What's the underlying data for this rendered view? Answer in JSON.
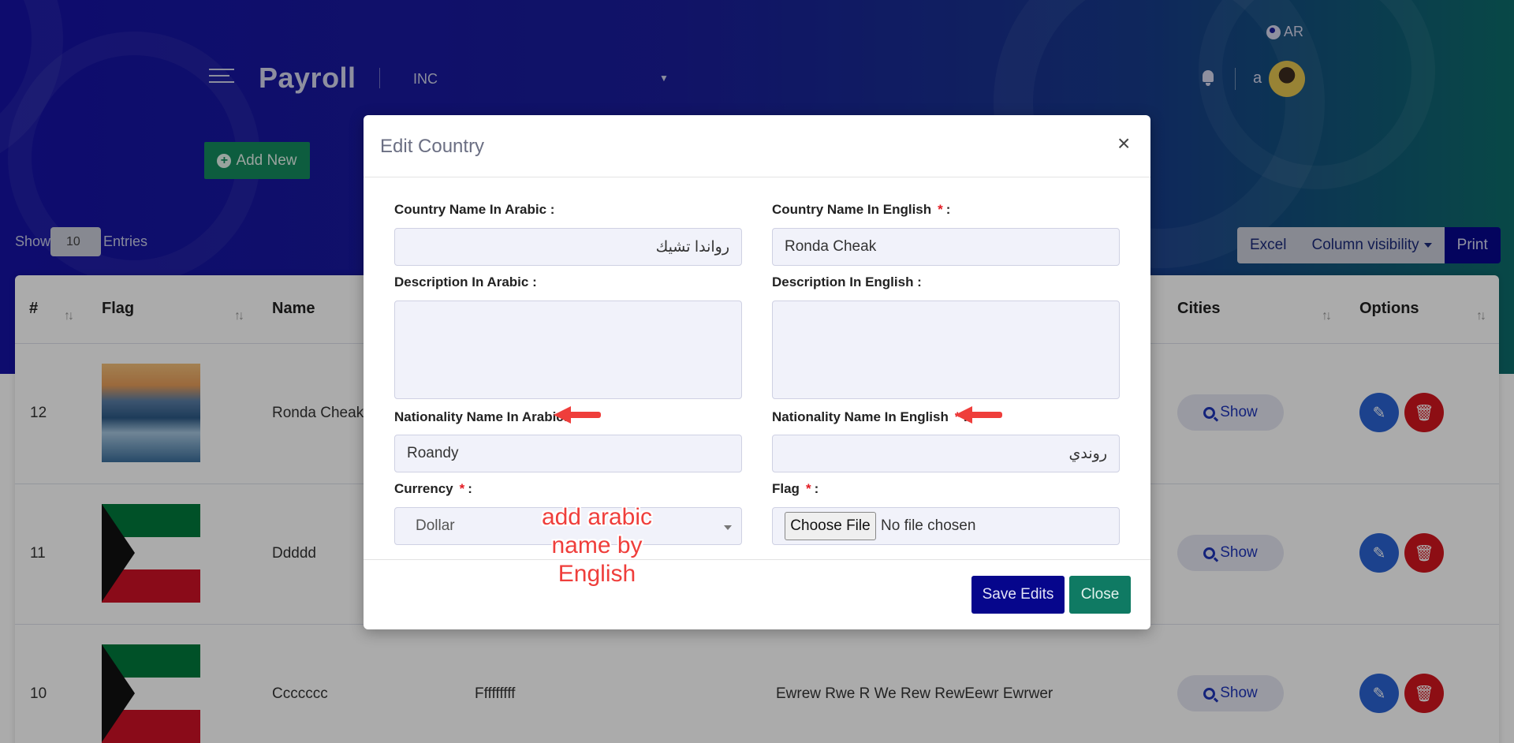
{
  "header": {
    "brand": "Payroll",
    "company": "INC",
    "language": "AR",
    "user_initial": "a"
  },
  "toolbar": {
    "add_new_label": "Add New",
    "show_label": "Show",
    "entries_value": "10",
    "entries_label": "Entries",
    "excel_label": "Excel",
    "column_visibility_label": "Column visibility",
    "print_label": "Print"
  },
  "table": {
    "columns": [
      "#",
      "Flag",
      "Name",
      "Cities",
      "Options"
    ],
    "rows": [
      {
        "id": "12",
        "name": "Ronda Cheak",
        "nationality": "",
        "description": "",
        "cities_label": "Show"
      },
      {
        "id": "11",
        "name": "Ddddd",
        "nationality": "",
        "description": "",
        "cities_label": "Show"
      },
      {
        "id": "10",
        "name": "Ccccccc",
        "nationality": "Fffffffff",
        "description": "Ewrew Rwe R We Rew RewEewr Ewrwer",
        "cities_label": "Show"
      }
    ]
  },
  "modal": {
    "title": "Edit Country",
    "close_symbol": "×",
    "fields": {
      "country_ar_label": "Country Name In Arabic :",
      "country_ar_value": "رواندا تشيك",
      "country_en_label": "Country Name In English",
      "country_en_value": "Ronda Cheak",
      "desc_ar_label": "Description In Arabic :",
      "desc_en_label": "Description In English :",
      "nat_ar_label": "Nationality Name In Arabic:",
      "nat_ar_value": "Roandy",
      "nat_en_label": "Nationality Name In English",
      "nat_en_value": "روندي",
      "currency_label": "Currency",
      "currency_value": "Dollar",
      "flag_label": "Flag",
      "choose_file_label": "Choose File",
      "no_file_label": "No file chosen",
      "required_mark": "*",
      "colon": ":"
    },
    "save_label": "Save Edits",
    "close_label": "Close"
  },
  "annotation": {
    "line1": "add arabic",
    "line2": "name by",
    "line3": "English",
    "color": "#ef3e3b"
  },
  "colors": {
    "primary": "#06068c",
    "success": "#148b5e",
    "danger": "#d3161f"
  }
}
